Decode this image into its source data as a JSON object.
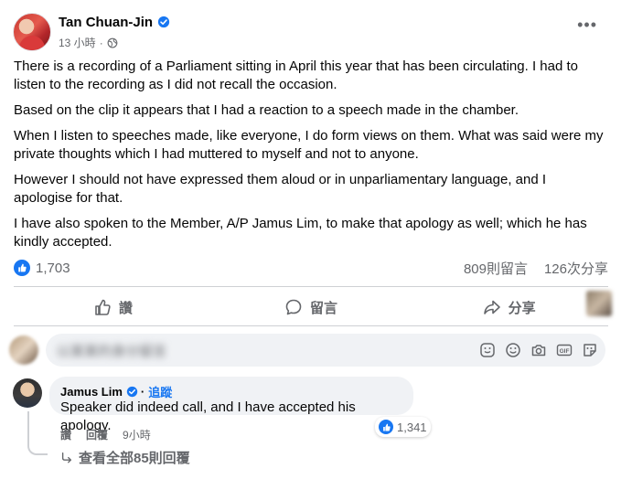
{
  "post": {
    "author": "Tan Chuan-Jin",
    "time": "13 小時",
    "meta_separator": "·",
    "paragraphs": [
      "There is a recording of a Parliament sitting in April this year that has been circulating. I had to listen to the recording as I did not recall the occasion.",
      "Based on the clip it appears that I had a reaction to a speech made in the chamber.",
      "When I listen to speeches made, like everyone, I do form views on them. What was said were my private thoughts which I had muttered to myself and not to anyone.",
      "However I should not have expressed them aloud or in unparliamentary language, and I apologise for that.",
      "I have also spoken to the Member, A/P Jamus Lim, to make that apology as well; which he has kindly accepted."
    ]
  },
  "stats": {
    "likes": "1,703",
    "comments": "809則留言",
    "shares": "126次分享"
  },
  "actions": {
    "like": "讚",
    "comment": "留言",
    "share": "分享"
  },
  "composer": {
    "placeholder": "以某某的身分留言"
  },
  "comment": {
    "author": "Jamus Lim",
    "separator": "·",
    "follow": "追蹤",
    "text": "Speaker did indeed call, and I have accepted his apology.",
    "like_label": "讚",
    "reply_label": "回覆",
    "time": "9小時",
    "reaction_count": "1,341"
  },
  "view_replies": "查看全部85則回覆",
  "icons": {
    "verified": "verified-badge-icon",
    "globe": "globe-icon",
    "more": "more-options-icon",
    "like": "thumbs-up-icon",
    "comment": "comment-bubble-icon",
    "share": "share-arrow-icon",
    "sticker": "sticker-icon",
    "emoji": "emoji-icon",
    "camera": "camera-icon",
    "gif": "gif-icon",
    "avatar_sticker": "avatar-sticker-icon",
    "reply_arrow": "reply-arrow-icon"
  },
  "colors": {
    "accent": "#1877f2",
    "secondary_text": "#65676b",
    "bubble": "#f0f2f5"
  }
}
